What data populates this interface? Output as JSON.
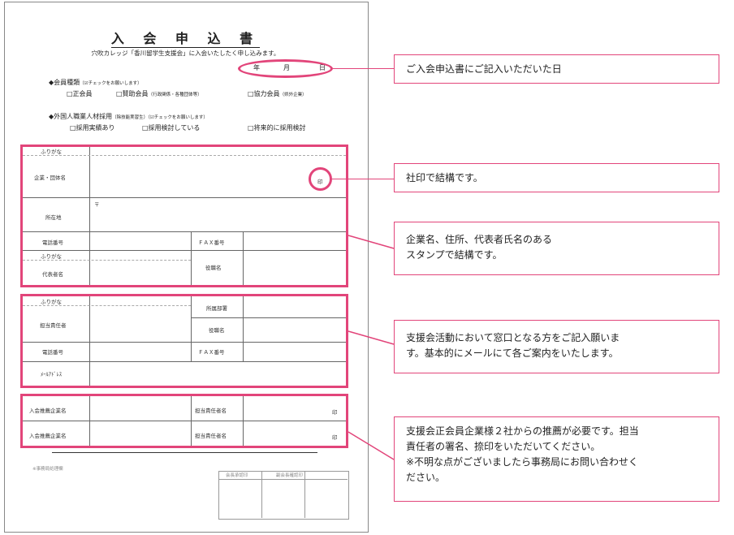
{
  "form": {
    "title": "入 会 申 込 書",
    "subtitle": "穴吹カレッジ「香川留学生支援会」に入会いたしたく申し込みます。",
    "date_year": "年",
    "date_month": "月",
    "date_day": "日",
    "membership": {
      "heading": "◆会員種類",
      "note": "（☑チェックをお願いします）",
      "opt1": "□正会員",
      "opt2": "□賛助会員",
      "opt2_note": "（行政関係・各種団体等）",
      "opt3": "□協力会員",
      "opt3_note": "（県外企業）"
    },
    "hiring": {
      "heading": "◆外国人職業人材採用",
      "heading_note": "（除技能実習生）（☑チェックをお願いします）",
      "opt1": "□採用実績あり",
      "opt2": "□採用検討している",
      "opt3": "□将来的に採用検討"
    },
    "company": {
      "furigana": "ふりがな",
      "name_label": "企業・団体名",
      "seal": "印",
      "postal": "〒",
      "address_label": "所在地",
      "phone_label": "電話番号",
      "fax_label": "ＦＡＸ番号",
      "furigana2": "ふりがな",
      "title_label": "役職名",
      "rep_label": "代表者名"
    },
    "contact": {
      "furigana": "ふりがな",
      "dept_label": "所属部署",
      "person_label": "担当責任者",
      "title_label": "役職名",
      "phone_label": "電話番号",
      "fax_label": "ＦＡＸ番号",
      "email_label": "ﾒｰﾙｱﾄﾞﾚｽ"
    },
    "recommend": {
      "row1_label": "入会推薦企業名",
      "row1_person": "担当責任者名",
      "row1_seal": "印",
      "row2_label": "入会推薦企業名",
      "row2_person": "担当責任者名",
      "row2_seal": "印"
    },
    "office_use": "※事務局処理欄",
    "stamp_box": {
      "col1": "会長承認印",
      "col2": "副会長確認印"
    }
  },
  "callouts": {
    "c1": "ご入会申込書にご記入いただいた日",
    "c2": "社印で結構です。",
    "c3_line1": "企業名、住所、代表者氏名のある",
    "c3_line2": "スタンプで結構です。",
    "c4_line1": "支援会活動において窓口となる方をご記入願いま",
    "c4_line2": "す。基本的にメールにて各ご案内をいたします。",
    "c5_line1": "支援会正会員企業様２社からの推薦が必要です。担当",
    "c5_line2": "責任者の署名、捺印をいただいてください。",
    "c5_line3": "※不明な点がございましたら事務局にお問い合わせく",
    "c5_line4": "ださい。"
  },
  "colors": {
    "accent": "#e2457a",
    "text": "#222222",
    "border": "#888888"
  }
}
